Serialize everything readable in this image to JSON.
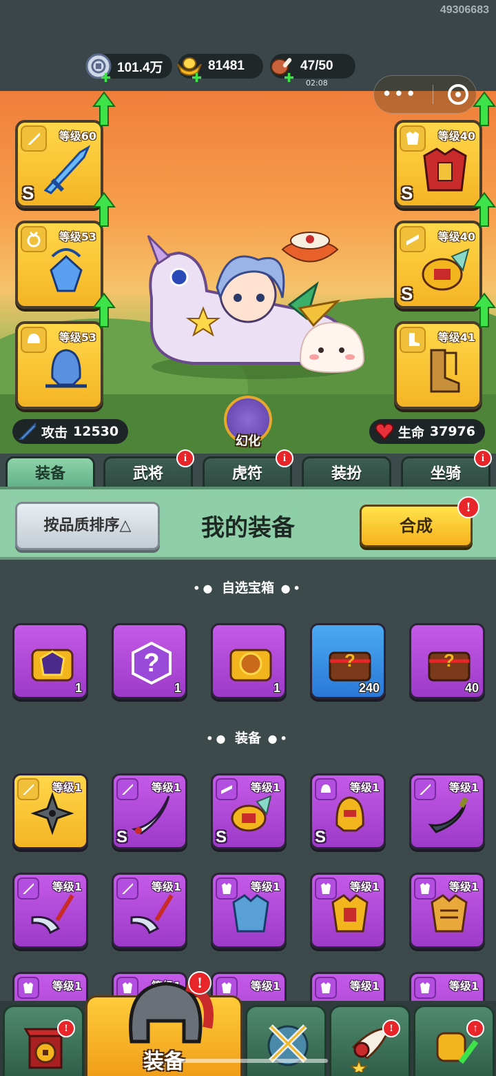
{
  "user_id": "49306683",
  "resources": {
    "silver": {
      "value": "101.4万",
      "icon": "silver-coin-icon"
    },
    "gold": {
      "value": "81481",
      "icon": "gold-ingot-icon"
    },
    "stamina": {
      "value": "47/50",
      "timer": "02:08",
      "icon": "meat-icon"
    }
  },
  "capsule": {
    "more": "•••",
    "close_icon": "target-icon"
  },
  "slots": {
    "left": [
      {
        "level": "等级60",
        "grade": "S",
        "category": "weapon",
        "upgradable": true
      },
      {
        "level": "等级53",
        "grade": "",
        "category": "necklace",
        "upgradable": true
      },
      {
        "level": "等级53",
        "grade": "",
        "category": "helmet",
        "upgradable": true
      }
    ],
    "right": [
      {
        "level": "等级40",
        "grade": "S",
        "category": "armor",
        "upgradable": true
      },
      {
        "level": "等级40",
        "grade": "S",
        "category": "belt",
        "upgradable": true
      },
      {
        "level": "等级41",
        "grade": "",
        "category": "boots",
        "upgradable": true
      }
    ]
  },
  "stats": {
    "attack": {
      "label": "攻击",
      "value": "12530"
    },
    "hp": {
      "label": "生命",
      "value": "37976"
    }
  },
  "transform_label": "幻化",
  "tabs": [
    {
      "label": "装备",
      "active": true,
      "badge": ""
    },
    {
      "label": "武将",
      "active": false,
      "badge": "i"
    },
    {
      "label": "虎符",
      "active": false,
      "badge": "i"
    },
    {
      "label": "装扮",
      "active": false,
      "badge": ""
    },
    {
      "label": "坐骑",
      "active": false,
      "badge": "i"
    }
  ],
  "equip_header": {
    "sort_label": "按品质排序△",
    "title": "我的装备",
    "synthesize_label": "合成",
    "synthesize_badge": "!"
  },
  "sections": {
    "chests": {
      "title": "自选宝箱",
      "items": [
        {
          "icon": "armor-chest-icon",
          "count": "1",
          "color": "purple"
        },
        {
          "icon": "mystery-box-icon",
          "count": "1",
          "color": "purple"
        },
        {
          "icon": "lion-chest-icon",
          "count": "1",
          "color": "purple"
        },
        {
          "icon": "mystery-chest-icon",
          "count": "240",
          "color": "blue"
        },
        {
          "icon": "mystery-chest-icon",
          "count": "40",
          "color": "purple"
        }
      ]
    },
    "equipment": {
      "title": "装备",
      "rows": [
        [
          {
            "icon": "shuriken-icon",
            "level": "等级1",
            "grade": "",
            "color": "gold",
            "category": "weapon"
          },
          {
            "icon": "scimitar-icon",
            "level": "等级1",
            "grade": "S",
            "color": "purple",
            "category": "weapon"
          },
          {
            "icon": "belt-icon",
            "level": "等级1",
            "grade": "S",
            "color": "purple",
            "category": "belt"
          },
          {
            "icon": "helmet-icon",
            "level": "等级1",
            "grade": "S",
            "color": "purple",
            "category": "helmet"
          },
          {
            "icon": "dagger-icon",
            "level": "等级1",
            "grade": "",
            "color": "purple",
            "category": "weapon"
          }
        ],
        [
          {
            "icon": "glaive-icon",
            "level": "等级1",
            "grade": "",
            "color": "purple",
            "category": "weapon"
          },
          {
            "icon": "glaive-icon",
            "level": "等级1",
            "grade": "",
            "color": "purple",
            "category": "weapon"
          },
          {
            "icon": "armor-icon",
            "level": "等级1",
            "grade": "",
            "color": "purple",
            "category": "armor"
          },
          {
            "icon": "armor-icon",
            "level": "等级1",
            "grade": "",
            "color": "purple",
            "category": "armor"
          },
          {
            "icon": "armor-icon",
            "level": "等级1",
            "grade": "",
            "color": "purple",
            "category": "armor"
          }
        ],
        [
          {
            "icon": "armor-icon",
            "level": "等级1",
            "color": "purple"
          },
          {
            "icon": "armor-icon",
            "level": "等级1",
            "color": "purple"
          },
          {
            "icon": "armor-icon",
            "level": "等级1",
            "color": "purple"
          },
          {
            "icon": "armor-icon",
            "level": "等级1",
            "color": "purple"
          },
          {
            "icon": "armor-icon",
            "level": "等级1",
            "color": "purple"
          }
        ]
      ]
    }
  },
  "bottom_nav": [
    {
      "icon": "gate-coin-icon",
      "label": "",
      "badge": "!"
    },
    {
      "icon": "helmet-icon",
      "label": "装备",
      "badge": "!",
      "active": true
    },
    {
      "icon": "crossed-swords-icon",
      "label": "",
      "badge": ""
    },
    {
      "icon": "horn-icon",
      "label": "",
      "badge": "!"
    },
    {
      "icon": "fist-upgrade-icon",
      "label": "",
      "badge": "↑"
    }
  ],
  "colors": {
    "accent_gold": "#f4b424",
    "epic_purple": "#b24ee0",
    "rare_blue": "#2a78d8",
    "upgrade_green": "#3ee34a",
    "badge_red": "#e8262a"
  }
}
